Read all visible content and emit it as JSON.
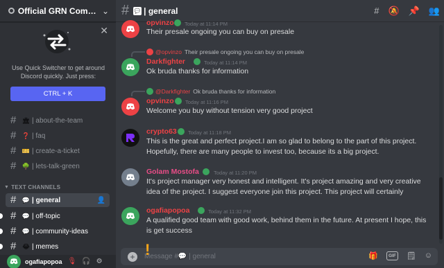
{
  "server": {
    "name": "Official GRN Commu…"
  },
  "quick_switcher": {
    "text": "Use Quick Switcher to get around Discord quickly. Just press:",
    "shortcut": "CTRL + K"
  },
  "channels_top": [
    {
      "emoji": "🏛",
      "label": "about-the-team"
    },
    {
      "emoji": "❓",
      "label": "faq"
    },
    {
      "emoji": "🎫",
      "label": "create-a-ticket"
    },
    {
      "emoji": "🌳",
      "label": "lets-talk-green"
    }
  ],
  "category": {
    "label": "TEXT CHANNELS"
  },
  "channels_text": [
    {
      "emoji": "💬",
      "label": "general"
    },
    {
      "emoji": "💬",
      "label": "off-topic"
    },
    {
      "emoji": "💬",
      "label": "community-ideas"
    },
    {
      "emoji": "😂",
      "label": "memes"
    }
  ],
  "user": {
    "name": "ogafiapopoa"
  },
  "header": {
    "channel": "| general"
  },
  "messages": [
    {
      "name": "opvinzo",
      "color": "#ed4245",
      "time": "Today at 11:14 PM",
      "text": "Their presale ongoing you can buy on presale"
    },
    {
      "reply_name": "@opvinzo",
      "reply_text": "Their presale ongoing you can buy on presale",
      "name": "Darkfighter",
      "color": "#ed4245",
      "time": "Today at 11:14 PM",
      "text": "Ok bruda thanks for information"
    },
    {
      "reply_name": "@Darkfighter",
      "reply_text": "Ok bruda thanks for information",
      "name": "opvinzo",
      "color": "#ed4245",
      "time": "Today at 11:16 PM",
      "text": "Welcome you buy without tension very good project"
    },
    {
      "name": "crypto63",
      "color": "#ed4245",
      "time": "Today at 11:18 PM",
      "text": "This is the great and perfect project.I am so glad to belong to the part of this project. Hopefully, there are many people to invest too, because its a big project."
    },
    {
      "name": "Golam Mostofa",
      "color": "#e94d87",
      "time": "Today at 11:20 PM",
      "text": "It's project manager very honest and intelligent. It's project amazing and very creative idea of the project. I suggest everyone join this project. This project will certainly"
    },
    {
      "name": "ogafiapopoa",
      "color": "#ed4245",
      "time": "Today at 11:32 PM",
      "text": "A qualified good team with good work, behind them in the future. At present I hope, this is get success"
    }
  ],
  "input": {
    "placeholder": "Message #💬 | general"
  },
  "colors": {
    "accent": "#5865f2",
    "online": "#3ba55d",
    "background": "#36393f",
    "sidebar": "#2f3136"
  }
}
